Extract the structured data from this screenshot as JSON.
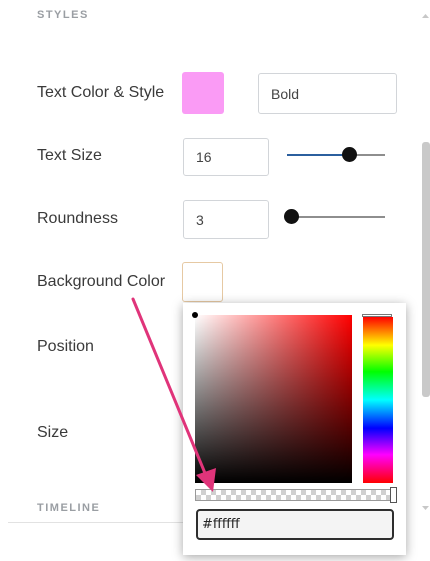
{
  "panel": {
    "styles_header": "STYLES",
    "timeline_header": "TIMELINE"
  },
  "rows": {
    "text_color_style": {
      "label": "Text Color & Style",
      "swatch_color": "#fa9bf5",
      "style_value": "Bold"
    },
    "text_size": {
      "label": "Text Size",
      "value": "16",
      "slider_level_percent": 64
    },
    "roundness": {
      "label": "Roundness",
      "value": "3",
      "slider_level_percent": 5
    },
    "background_color": {
      "label": "Background Color",
      "swatch_color": "#ffffff"
    },
    "position": {
      "label": "Position"
    },
    "size": {
      "label": "Size"
    }
  },
  "color_picker": {
    "hex_value": "#ffffff",
    "hue_color": "#ff0000"
  },
  "colors": {
    "accent": "#2b5f9e",
    "annotation_arrow": "#e0347a",
    "header_text": "#9a9ea3"
  },
  "icons": {
    "scroll_up": "scroll-up-arrow-icon",
    "scroll_down": "scroll-down-arrow-icon"
  }
}
